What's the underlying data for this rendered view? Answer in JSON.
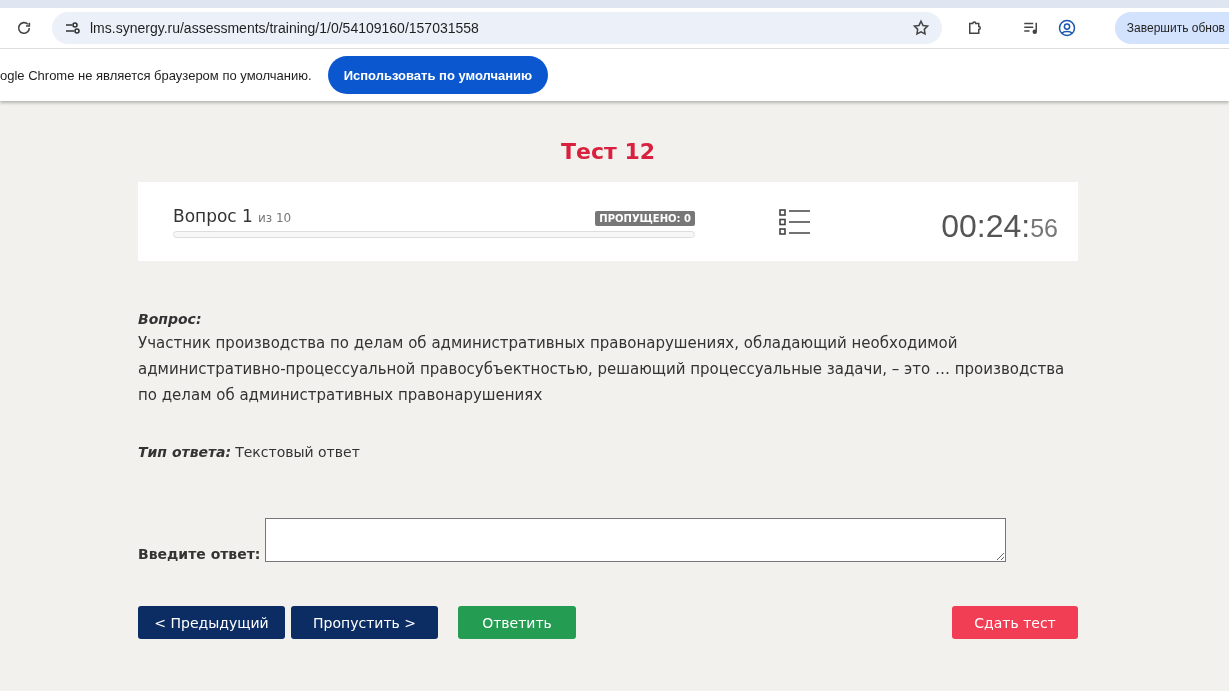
{
  "browser": {
    "url": "lms.synergy.ru/assessments/training/1/0/54109160/157031558",
    "update_button": "Завершить обнов"
  },
  "infobar": {
    "message": "ogle Chrome не является браузером по умолчанию.",
    "button": "Использовать по умолчанию"
  },
  "test": {
    "title": "Тест 12"
  },
  "progress": {
    "question_label": "Вопрос 1",
    "of_label": "из 10",
    "skipped_badge": "ПРОПУЩЕНО: 0",
    "timer_main": "00:24:",
    "timer_seconds": "56"
  },
  "question": {
    "heading": "Вопрос:",
    "text": "Участник производства по делам об административных правонарушениях, обладающий необходимой административно-процессуальной правосубъектностью, решающий процессуальные задачи, – это … производства по делам об административных правонарушениях",
    "answer_type_label": "Тип ответа:",
    "answer_type": "Текстовый ответ"
  },
  "answer": {
    "label": "Введите ответ:"
  },
  "buttons": [
    {
      "label": "< Предыдущий",
      "kind": "nav"
    },
    {
      "label": "Пропустить >",
      "kind": "nav"
    },
    {
      "label": "Ответить",
      "kind": "submit"
    },
    {
      "label": "Сдать тест",
      "kind": "finish"
    }
  ]
}
